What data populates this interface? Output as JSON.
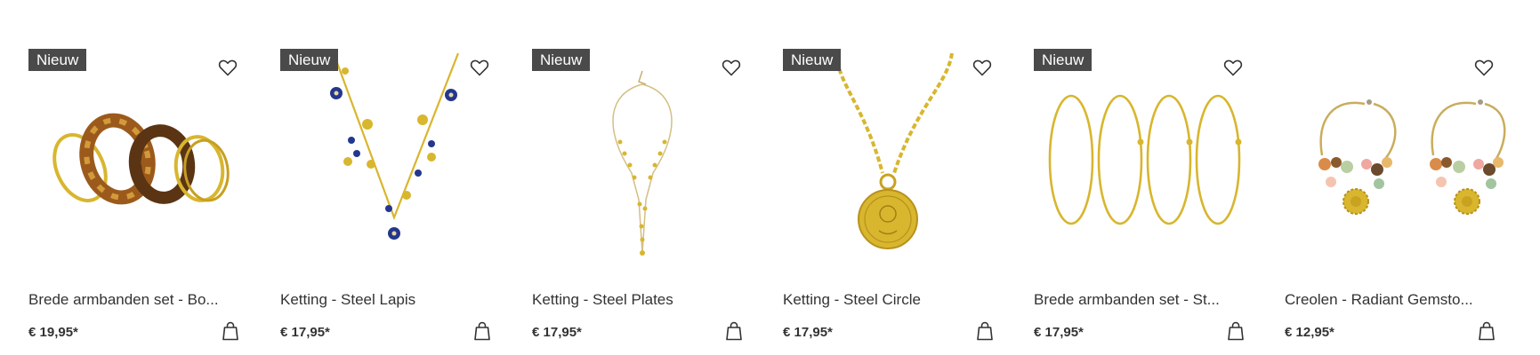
{
  "products": [
    {
      "badge": "Nieuw",
      "name": "Brede armbanden set - Bo...",
      "price": "€ 19,95*"
    },
    {
      "badge": "Nieuw",
      "name": "Ketting - Steel Lapis",
      "price": "€ 17,95*"
    },
    {
      "badge": "Nieuw",
      "name": "Ketting - Steel Plates",
      "price": "€ 17,95*"
    },
    {
      "badge": "Nieuw",
      "name": "Ketting - Steel Circle",
      "price": "€ 17,95*"
    },
    {
      "badge": "Nieuw",
      "name": "Brede armbanden set - St...",
      "price": "€ 17,95*"
    },
    {
      "badge": "",
      "name": "Creolen - Radiant Gemsto...",
      "price": "€ 12,95*"
    }
  ],
  "icons": {
    "wishlist": "heart-icon",
    "cart": "shopping-bag-icon"
  },
  "colors": {
    "badge_bg": "#4a4a4a",
    "gold": "#d8b62e",
    "lapis": "#24378e",
    "text": "#333333"
  }
}
